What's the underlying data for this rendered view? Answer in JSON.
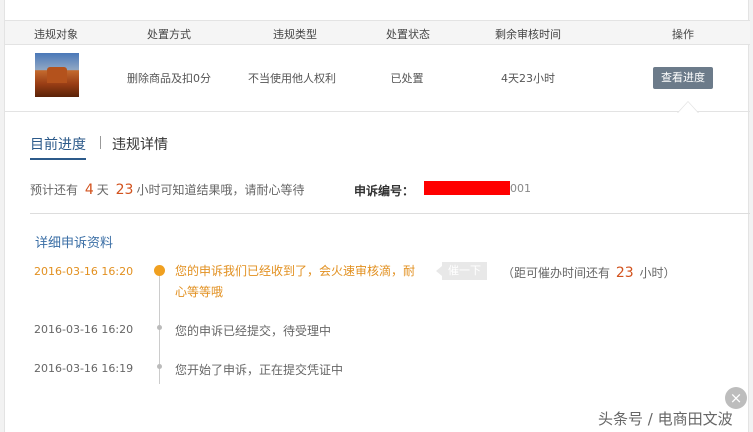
{
  "table": {
    "headers": [
      "违规对象",
      "处置方式",
      "违规类型",
      "处置状态",
      "剩余审核时间",
      "操作"
    ],
    "row": {
      "image_alt": "desert rock photo",
      "method": "删除商品及扣0分",
      "type": "不当使用他人权利",
      "status": "已处置",
      "remaining": "4天23小时",
      "action": "查看进度"
    }
  },
  "tabs": {
    "current": "目前进度",
    "details": "违规详情"
  },
  "estimate": {
    "prefix": "预计还有",
    "days": "4",
    "days_unit": "天",
    "hours": "23",
    "suffix": "小时可知道结果哦，请耐心等待"
  },
  "appeal": {
    "label": "申诉编号：",
    "number_suffix": "001"
  },
  "section_title": "详细申诉资料",
  "timeline": [
    {
      "time": "2016-03-16 16:20",
      "text": "您的申诉我们已经收到了，会火速审核滴，耐心等等哦"
    },
    {
      "time": "2016-03-16 16:20",
      "text": "您的申诉已经提交，待受理中"
    },
    {
      "time": "2016-03-16 16:19",
      "text": "您开始了申诉，正在提交凭证中"
    }
  ],
  "urge": {
    "button": "催一下",
    "note_prefix": "（距可催办时间还有",
    "hours": "23",
    "note_suffix": "小时）"
  },
  "close_icon": "×",
  "watermark": "头条号 / 电商田文波",
  "colors": {
    "accent_orange": "#e29020",
    "number_red": "#d2521d",
    "link_blue": "#3a6ea5",
    "button_gray": "#6c7b8a",
    "redaction": "#ff0000"
  }
}
